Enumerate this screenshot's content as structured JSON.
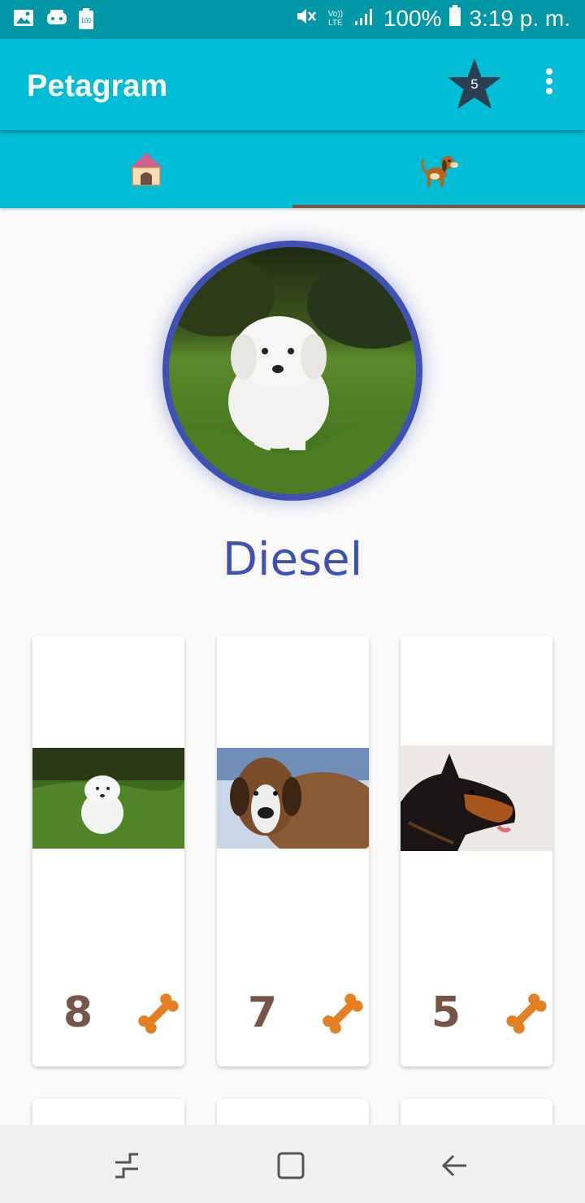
{
  "status_bar": {
    "left_icons": [
      "gallery-notification-icon",
      "game-notification-icon",
      "battery-saver-notification-icon"
    ],
    "right_icons": [
      "mute-icon",
      "volte-icon",
      "signal-icon",
      "battery-icon"
    ],
    "volte_label": "Vo)) LTE",
    "battery_percent": "100%",
    "time": "3:19 p. m."
  },
  "app_bar": {
    "title": "Petagram",
    "favorites_count": "5"
  },
  "tabs": [
    {
      "icon": "doghouse-icon",
      "selected": false
    },
    {
      "icon": "dog-icon",
      "selected": true
    }
  ],
  "profile": {
    "name": "Diesel"
  },
  "grid": [
    {
      "photo": "maltese-puppy-photo",
      "likes": "8"
    },
    {
      "photo": "saint-bernard-photo",
      "likes": "7"
    },
    {
      "photo": "doberman-photo",
      "likes": "5"
    }
  ],
  "colors": {
    "status_bar": "#0097a7",
    "app_bar": "#00bcd4",
    "accent": "#3f51b5",
    "likes_text": "#795548",
    "bone": "#e67e22",
    "tab_indicator": "#795548"
  },
  "nav_bar": [
    "recent-apps-icon",
    "home-icon",
    "back-icon"
  ]
}
